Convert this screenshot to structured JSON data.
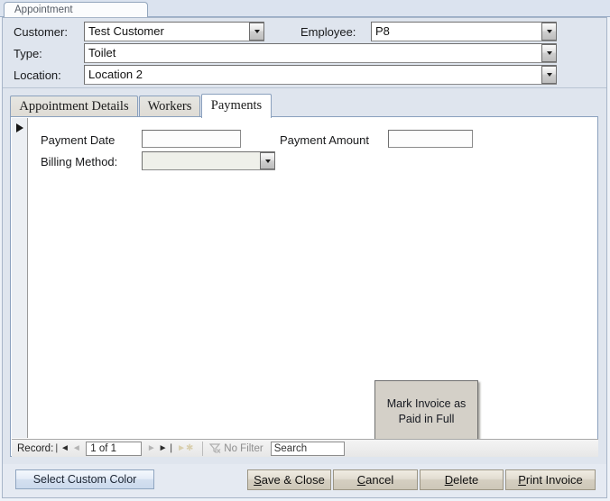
{
  "window": {
    "document_tab_label": "Appointment"
  },
  "header": {
    "fields": [
      {
        "label": "Customer:",
        "value": "Test Customer",
        "type": "combobox"
      },
      {
        "label": "Type:",
        "value": "Toilet",
        "type": "combobox"
      },
      {
        "label": "Location:",
        "value": "Location 2",
        "type": "combobox"
      },
      {
        "label": "Employee:",
        "value": "P8",
        "type": "combobox"
      }
    ]
  },
  "tabs": {
    "items": [
      {
        "label": "Appointment Details",
        "active": false
      },
      {
        "label": "Workers",
        "active": false
      },
      {
        "label": "Payments",
        "active": true
      }
    ]
  },
  "payments_page": {
    "payment_date_label": "Payment Date",
    "payment_date_value": "",
    "calendar_icon": "calendar-icon",
    "payment_amount_label": "Payment Amount",
    "payment_amount_value": "",
    "billing_method_label": "Billing Method:",
    "billing_method_value": "",
    "mark_paid_button_line1": "Mark Invoice as",
    "mark_paid_button_line2": "Paid in Full"
  },
  "nav_bar": {
    "record_label": "Record:",
    "first_icon": "❘◄",
    "prev_icon": "◄",
    "position": "1 of 1",
    "next_icon": "►",
    "last_icon": "►❘",
    "new_icon": "►✱",
    "filter_icon": "filter-icon",
    "filter_label": "No Filter",
    "search_placeholder": "Search",
    "search_value": "Search"
  },
  "footer": {
    "select_color_label": "Select Custom Color",
    "buttons": [
      {
        "accel": "S",
        "rest": "ave & Close"
      },
      {
        "accel": "C",
        "rest": "ancel"
      },
      {
        "accel": "D",
        "rest": "elete"
      },
      {
        "accel": "P",
        "rest": "rint Invoice"
      }
    ]
  },
  "colors": {
    "form_background": "#dfe5ee",
    "page_background": "#ffffff",
    "button_face": "#d4d0c8",
    "tab_border": "#8aa0bd"
  }
}
